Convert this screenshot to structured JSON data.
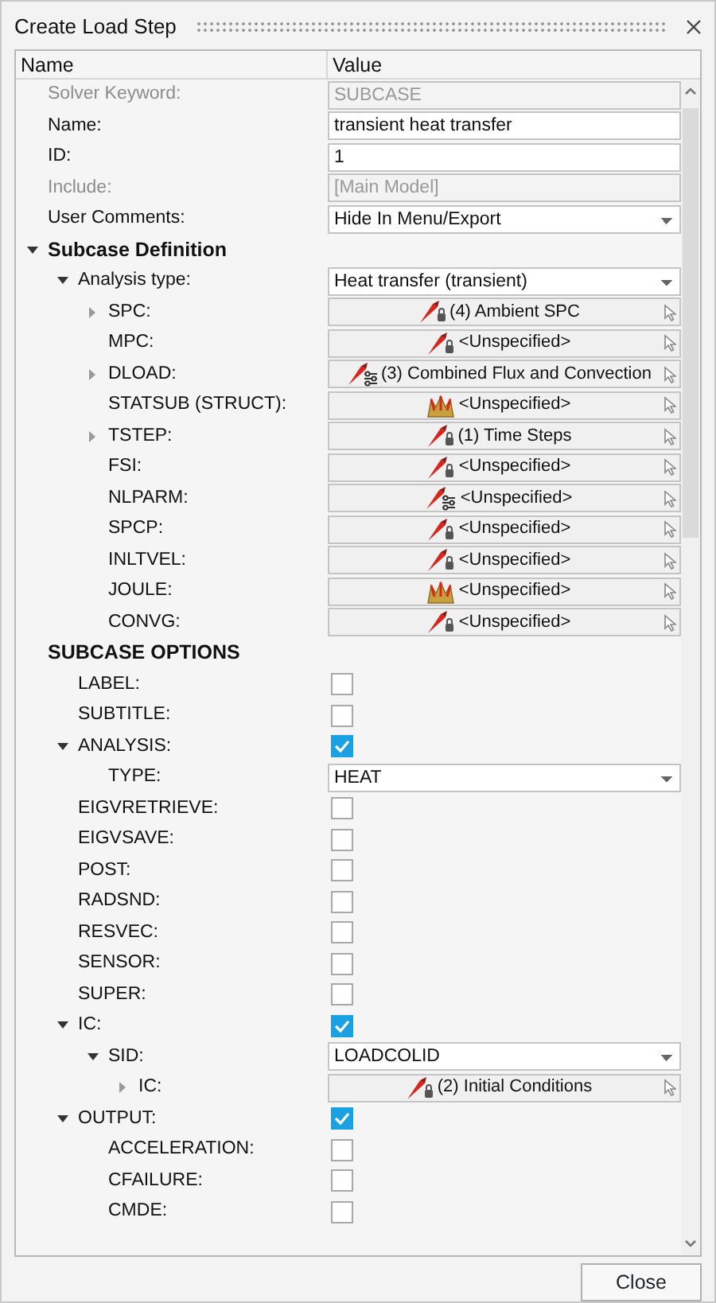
{
  "dialog": {
    "title": "Create Load Step"
  },
  "columns": [
    "Name",
    "Value"
  ],
  "rows": [
    {
      "label": "Solver Keyword:",
      "kind": "text",
      "value": "SUBCASE",
      "disabled": true
    },
    {
      "label": "Name:",
      "kind": "text",
      "value": "transient heat transfer",
      "disabled": false
    },
    {
      "label": "ID:",
      "kind": "text",
      "value": "1",
      "disabled": false
    },
    {
      "label": "Include:",
      "kind": "select",
      "value": "[Main Model]",
      "disabled": true
    },
    {
      "label": "User Comments:",
      "kind": "select",
      "value": "Hide In Menu/Export",
      "disabled": false
    },
    {
      "label": "Subcase Definition",
      "kind": "section",
      "expanded": true,
      "children": [
        {
          "label": "Analysis type:",
          "kind": "select",
          "value": "Heat transfer (transient)",
          "disabled": false,
          "expanded": true,
          "children": [
            {
              "label": "SPC:",
              "kind": "load",
              "value": "(4) Ambient SPC",
              "expanded": false
            },
            {
              "label": "MPC:",
              "kind": "load",
              "value": "<Unspecified>"
            },
            {
              "label": "DLOAD:",
              "kind": "loadset",
              "value": "(3) Combined Flux and Convection",
              "expanded": false
            },
            {
              "label": "STATSUB (STRUCT):",
              "kind": "subcase",
              "value": "<Unspecified>"
            },
            {
              "label": "TSTEP:",
              "kind": "load",
              "value": "(1) Time Steps",
              "expanded": false
            },
            {
              "label": "FSI:",
              "kind": "load",
              "value": "<Unspecified>"
            },
            {
              "label": "NLPARM:",
              "kind": "loadset",
              "value": "<Unspecified>"
            },
            {
              "label": "SPCP:",
              "kind": "load",
              "value": "<Unspecified>"
            },
            {
              "label": "INLTVEL:",
              "kind": "load",
              "value": "<Unspecified>"
            },
            {
              "label": "JOULE:",
              "kind": "subcase",
              "value": "<Unspecified>"
            },
            {
              "label": "CONVG:",
              "kind": "load",
              "value": "<Unspecified>"
            }
          ]
        }
      ]
    },
    {
      "label": "SUBCASE OPTIONS",
      "kind": "section",
      "children": [
        {
          "label": "LABEL:",
          "kind": "checkbox",
          "checked": false
        },
        {
          "label": "SUBTITLE:",
          "kind": "checkbox",
          "checked": false
        },
        {
          "label": "ANALYSIS:",
          "kind": "checkbox",
          "checked": true,
          "expanded": true,
          "children": [
            {
              "label": "TYPE:",
              "kind": "select",
              "value": "HEAT",
              "disabled": false
            }
          ]
        },
        {
          "label": "EIGVRETRIEVE:",
          "kind": "checkbox",
          "checked": false
        },
        {
          "label": "EIGVSAVE:",
          "kind": "checkbox",
          "checked": false
        },
        {
          "label": "POST:",
          "kind": "checkbox",
          "checked": false
        },
        {
          "label": "RADSND:",
          "kind": "checkbox",
          "checked": false
        },
        {
          "label": "RESVEC:",
          "kind": "checkbox",
          "checked": false
        },
        {
          "label": "SENSOR:",
          "kind": "checkbox",
          "checked": false
        },
        {
          "label": "SUPER:",
          "kind": "checkbox",
          "checked": false
        },
        {
          "label": "IC:",
          "kind": "checkbox",
          "checked": true,
          "expanded": true,
          "children": [
            {
              "label": "SID:",
              "kind": "select",
              "value": "LOADCOLID",
              "disabled": false,
              "expanded": true,
              "children": [
                {
                  "label": "IC:",
                  "kind": "load",
                  "value": "(2) Initial Conditions",
                  "expanded": false
                }
              ]
            }
          ]
        },
        {
          "label": "OUTPUT:",
          "kind": "checkbox",
          "checked": true,
          "expanded": true,
          "children": [
            {
              "label": "ACCELERATION:",
              "kind": "checkbox",
              "checked": false
            },
            {
              "label": "CFAILURE:",
              "kind": "checkbox",
              "checked": false
            },
            {
              "label": "CMDE:",
              "kind": "checkbox",
              "checked": false
            }
          ]
        }
      ]
    }
  ],
  "buttons": [
    "Close"
  ]
}
